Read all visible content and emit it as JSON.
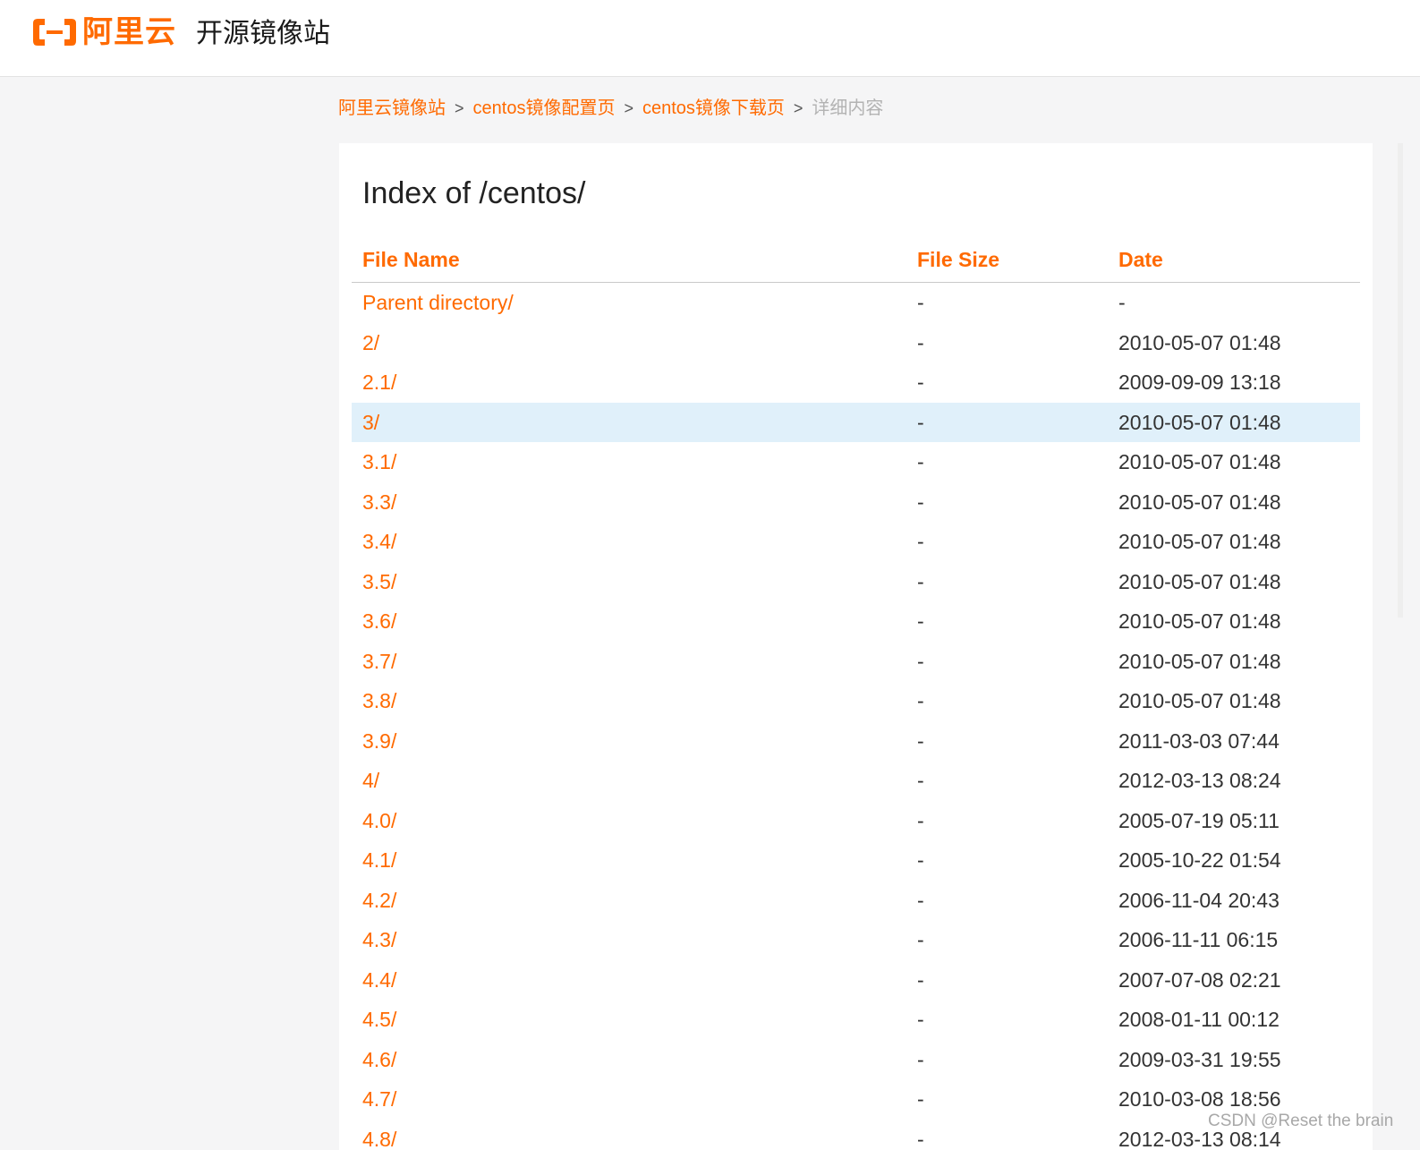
{
  "header": {
    "logo_text": "阿里云",
    "site_name": "开源镜像站",
    "brand_color": "#ff6a00"
  },
  "breadcrumb": {
    "items": [
      "阿里云镜像站",
      "centos镜像配置页",
      "centos镜像下载页"
    ],
    "separator": ">",
    "current": "详细内容"
  },
  "main": {
    "title": "Index of /centos/",
    "columns": {
      "name": "File Name",
      "size": "File Size",
      "date": "Date"
    },
    "rows": [
      {
        "name": "Parent directory/",
        "size": "-",
        "date": "-"
      },
      {
        "name": "2/",
        "size": "-",
        "date": "2010-05-07 01:48"
      },
      {
        "name": "2.1/",
        "size": "-",
        "date": "2009-09-09 13:18"
      },
      {
        "name": "3/",
        "size": "-",
        "date": "2010-05-07 01:48"
      },
      {
        "name": "3.1/",
        "size": "-",
        "date": "2010-05-07 01:48"
      },
      {
        "name": "3.3/",
        "size": "-",
        "date": "2010-05-07 01:48"
      },
      {
        "name": "3.4/",
        "size": "-",
        "date": "2010-05-07 01:48"
      },
      {
        "name": "3.5/",
        "size": "-",
        "date": "2010-05-07 01:48"
      },
      {
        "name": "3.6/",
        "size": "-",
        "date": "2010-05-07 01:48"
      },
      {
        "name": "3.7/",
        "size": "-",
        "date": "2010-05-07 01:48"
      },
      {
        "name": "3.8/",
        "size": "-",
        "date": "2010-05-07 01:48"
      },
      {
        "name": "3.9/",
        "size": "-",
        "date": "2011-03-03 07:44"
      },
      {
        "name": "4/",
        "size": "-",
        "date": "2012-03-13 08:24"
      },
      {
        "name": "4.0/",
        "size": "-",
        "date": "2005-07-19 05:11"
      },
      {
        "name": "4.1/",
        "size": "-",
        "date": "2005-10-22 01:54"
      },
      {
        "name": "4.2/",
        "size": "-",
        "date": "2006-11-04 20:43"
      },
      {
        "name": "4.3/",
        "size": "-",
        "date": "2006-11-11 06:15"
      },
      {
        "name": "4.4/",
        "size": "-",
        "date": "2007-07-08 02:21"
      },
      {
        "name": "4.5/",
        "size": "-",
        "date": "2008-01-11 00:12"
      },
      {
        "name": "4.6/",
        "size": "-",
        "date": "2009-03-31 19:55"
      },
      {
        "name": "4.7/",
        "size": "-",
        "date": "2010-03-08 18:56"
      },
      {
        "name": "4.8/",
        "size": "-",
        "date": "2012-03-13 08:14"
      }
    ],
    "highlighted_row": "3/",
    "highlight_color": "#e0f0fa"
  },
  "watermark": "CSDN @Reset the brain"
}
